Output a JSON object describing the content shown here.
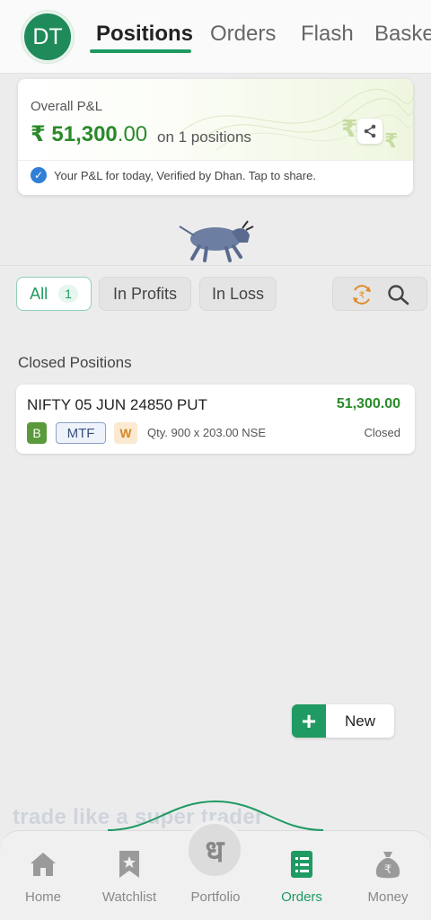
{
  "header": {
    "avatar_initials": "DT",
    "tabs": [
      {
        "label": "Positions",
        "active": true
      },
      {
        "label": "Orders",
        "active": false
      },
      {
        "label": "Flash",
        "active": false
      },
      {
        "label": "Basket",
        "active": false
      }
    ]
  },
  "pl_card": {
    "label": "Overall P&L",
    "value_main": "₹ 51,300",
    "value_decimal": ".00",
    "suffix": "on 1 positions",
    "verify_text": "Your P&L for today, Verified by Dhan. Tap to share."
  },
  "filters": {
    "all_label": "All",
    "all_count": "1",
    "profits_label": "In Profits",
    "loss_label": "In Loss"
  },
  "closed_positions": {
    "title": "Closed Positions",
    "items": [
      {
        "name": "NIFTY 05 JUN 24850 PUT",
        "pnl": "51,300.00",
        "badge_side": "B",
        "badge_product": "MTF",
        "badge_extra": "W",
        "qty": "Qty. 900 x 203.00 NSE",
        "status": "Closed"
      }
    ]
  },
  "new_button": {
    "plus": "+",
    "label": "New"
  },
  "tagline": "trade like a super trader",
  "bottom_nav": {
    "items": [
      {
        "label": "Home",
        "icon": "home-icon"
      },
      {
        "label": "Watchlist",
        "icon": "bookmark-icon"
      },
      {
        "label": "Portfolio",
        "icon": "dhan-logo-icon"
      },
      {
        "label": "Orders",
        "icon": "orders-icon",
        "active": true
      },
      {
        "label": "Money",
        "icon": "money-bag-icon"
      }
    ],
    "portfolio_glyph": "ध"
  },
  "colors": {
    "accent": "#1f9a62",
    "profit": "#2a8a2a",
    "verify": "#2f7fd6"
  }
}
